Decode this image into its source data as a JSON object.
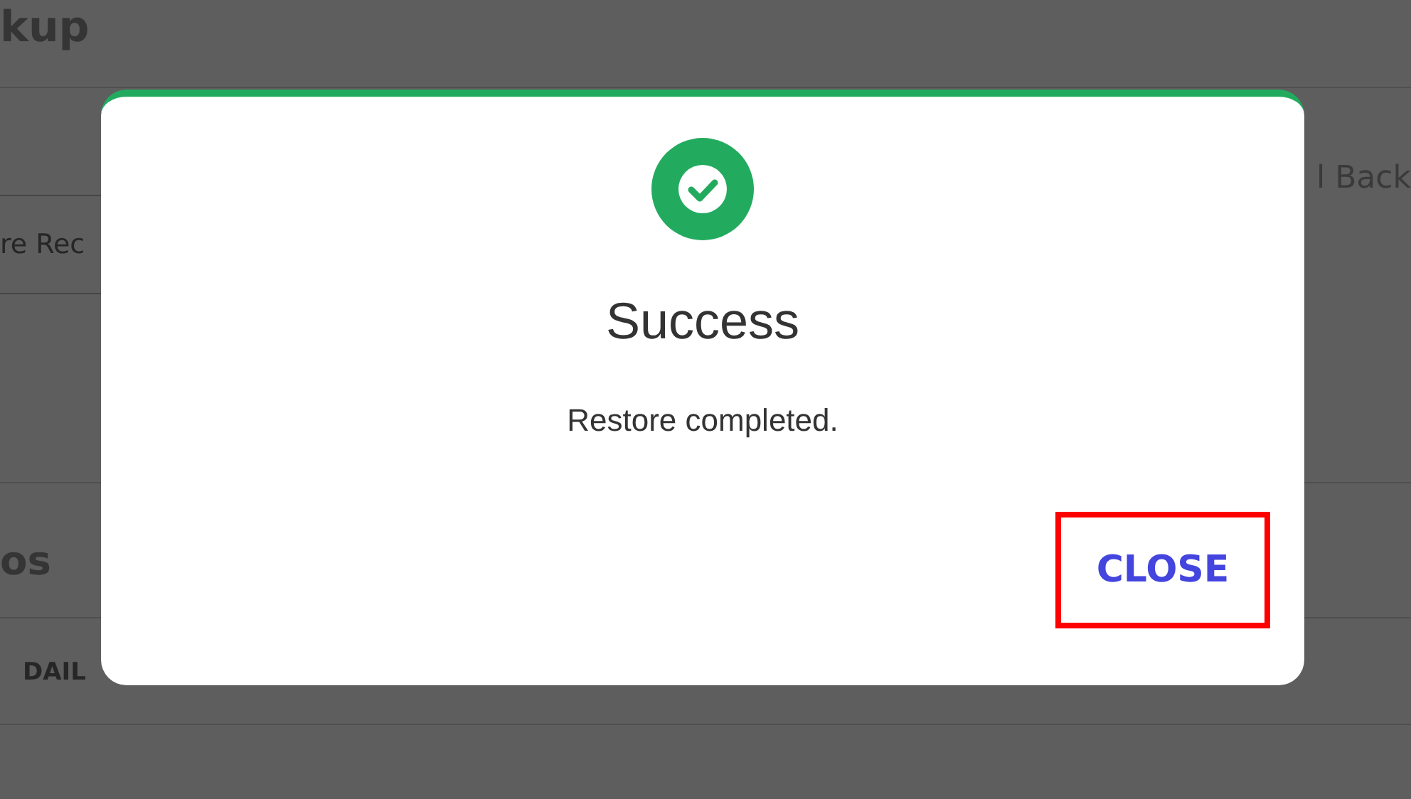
{
  "page": {
    "heading": "kup",
    "action_label": "l Back",
    "field_value": "re Rec",
    "section_heading": "os",
    "table_header": "DAIL"
  },
  "dialog": {
    "kind": "success",
    "title": "Success",
    "message": "Restore completed.",
    "close_button": {
      "label": "CLOSE",
      "highlighted": true
    }
  }
}
